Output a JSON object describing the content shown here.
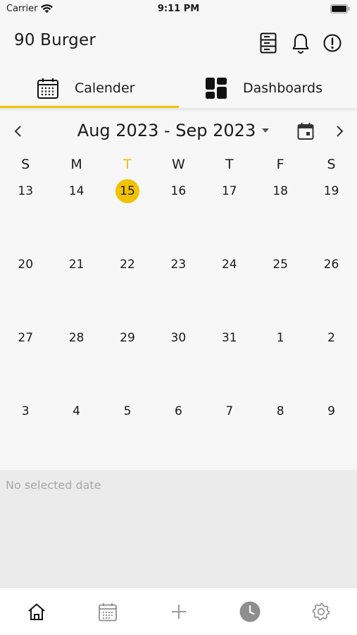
{
  "status_bar": {
    "carrier": "Carrier",
    "time": "9:11 PM"
  },
  "header": {
    "title": "90 Burger",
    "icons": [
      "server-rack-icon",
      "bell-icon",
      "alert-circle-icon"
    ]
  },
  "tabs": [
    {
      "label": "Calender",
      "icon": "calendar-icon",
      "active": true
    },
    {
      "label": "Dashboards",
      "icon": "dashboard-icon",
      "active": false
    }
  ],
  "calendar": {
    "range_label": "Aug 2023 - Sep 2023",
    "weekdays": [
      "S",
      "M",
      "T",
      "W",
      "T",
      "F",
      "S"
    ],
    "today_column": 2,
    "weeks": [
      [
        "13",
        "14",
        "15",
        "16",
        "17",
        "18",
        "19"
      ],
      [
        "20",
        "21",
        "22",
        "23",
        "24",
        "25",
        "26"
      ],
      [
        "27",
        "28",
        "29",
        "30",
        "31",
        "1",
        "2"
      ],
      [
        "3",
        "4",
        "5",
        "6",
        "7",
        "8",
        "9"
      ]
    ],
    "selected_day": "15"
  },
  "panel": {
    "empty_text": "No selected date"
  },
  "bottom_nav": [
    "home-icon",
    "calendar-icon",
    "plus-icon",
    "clock-icon",
    "settings-icon"
  ],
  "colors": {
    "accent": "#f2c200",
    "background": "#f7f7f7",
    "panel": "#ebebeb",
    "muted": "#a7a7a7"
  }
}
